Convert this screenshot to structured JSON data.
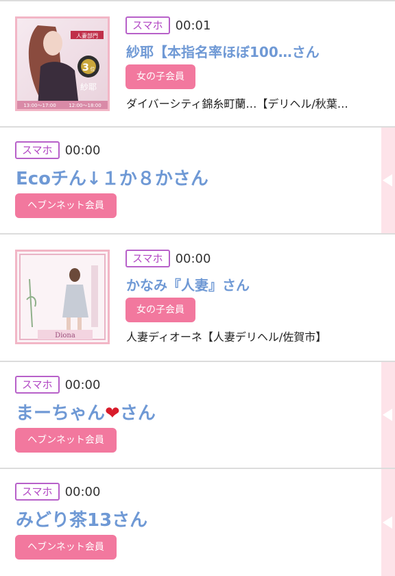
{
  "entries": [
    {
      "platform_badge": "スマホ",
      "time": "00:01",
      "name": "紗耶【本指名率ほぼ100…さん",
      "member_type": "女の子会員",
      "shop": "ダイバーシティ錦糸町蘭…【デリヘル/秋葉…",
      "thumb_text": {
        "rank_label": "人妻部門",
        "rank_num": "3",
        "rank_suffix": "位",
        "caption": "紗耶",
        "hours_left": "13:00〜17:00",
        "hours_right": "12:00〜18:00"
      }
    },
    {
      "platform_badge": "スマホ",
      "time": "00:00",
      "name": "Ecoチん↓１か８かさん",
      "member_type": "ヘブンネット会員"
    },
    {
      "platform_badge": "スマホ",
      "time": "00:00",
      "name": "かなみ『人妻』さん",
      "member_type": "女の子会員",
      "shop": "人妻ディオーネ【人妻デリヘル/佐賀市】",
      "thumb_text": {
        "logo": "Diona"
      }
    },
    {
      "platform_badge": "スマホ",
      "time": "00:00",
      "name_prefix": "まーちゃん",
      "name_heart": "❤",
      "name_suffix": "さん",
      "member_type": "ヘブンネット会員"
    },
    {
      "platform_badge": "スマホ",
      "time": "00:00",
      "name": "みどり茶13さん",
      "member_type": "ヘブンネット会員"
    }
  ],
  "colors": {
    "name_blue": "#6f99d5",
    "badge_purple": "#b248c4",
    "member_pink": "#f2789e",
    "side_tab_pink": "#fde3e9"
  },
  "icons": {
    "side_tab": "chevron-left-icon"
  }
}
